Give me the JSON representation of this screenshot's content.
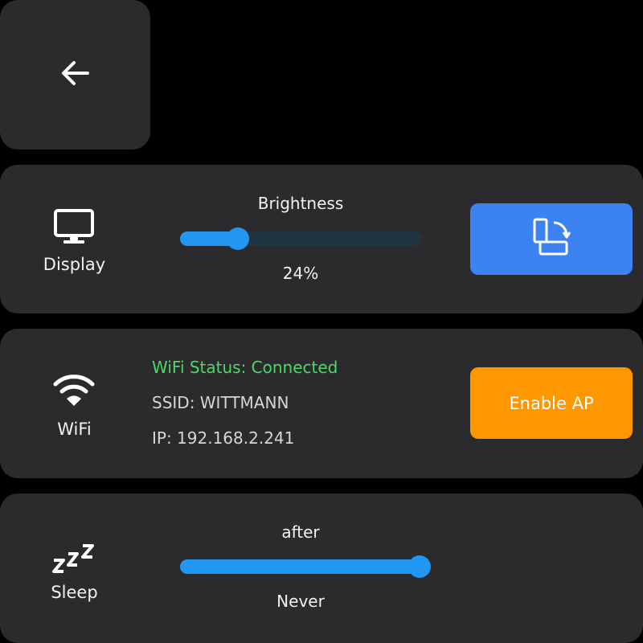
{
  "back": {
    "icon": "arrow-left-icon"
  },
  "display": {
    "icon": "monitor-icon",
    "label": "Display",
    "slider_caption": "Brightness",
    "brightness_value": 24,
    "brightness_text": "24%",
    "rotate_icon": "rotate-screen-icon"
  },
  "wifi": {
    "icon": "wifi-icon",
    "label": "WiFi",
    "status_text": "WiFi Status: Connected",
    "ssid_text": "SSID: WITTMANN",
    "ip_text": "IP: 192.168.2.241",
    "ap_button_label": "Enable AP"
  },
  "sleep": {
    "icon": "sleep-icon",
    "label": "Sleep",
    "slider_caption": "after",
    "slider_value": 100,
    "value_text": "Never"
  },
  "colors": {
    "background": "#000000",
    "card": "#2b2a2c",
    "slider_fill": "#2196f3",
    "slider_track": "#1f3542",
    "rotate_button": "#3d82f1",
    "ap_button": "#ff9800",
    "status_connected": "#4cd964"
  }
}
